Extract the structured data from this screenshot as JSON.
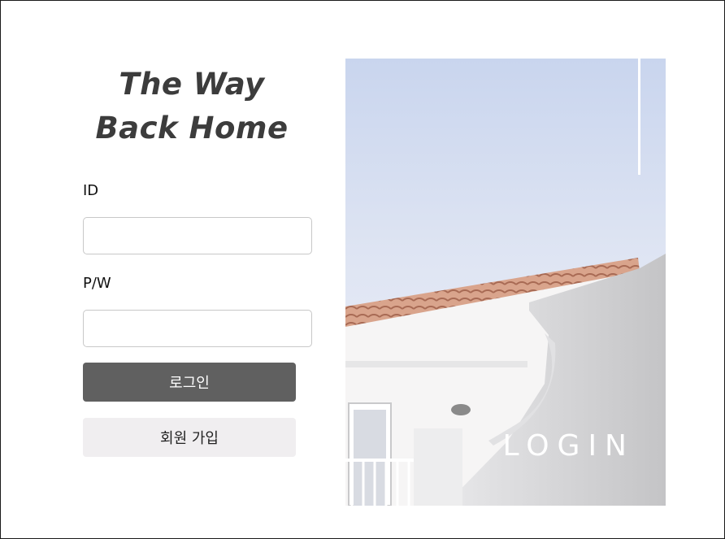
{
  "brand": {
    "line1": "The Way",
    "line2": "Back Home"
  },
  "form": {
    "id_label": "ID",
    "pw_label": "P/W",
    "id_value": "",
    "pw_value": "",
    "login_button": "로그인",
    "signup_button": "회원 가입"
  },
  "hero": {
    "title": "LOGIN"
  },
  "colors": {
    "login_button_bg": "#606060",
    "signup_button_bg": "#f0eef0",
    "logo_text": "#3c3c3c"
  },
  "icons": [
    "house-photo"
  ]
}
